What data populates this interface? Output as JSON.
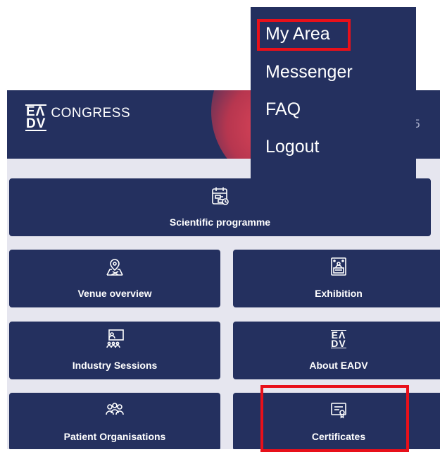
{
  "header": {
    "logo_top": "EΛ",
    "logo_bottom": "DV",
    "logo_text": "CONGRESS",
    "date_fragment": ")25"
  },
  "tiles": {
    "scientific_programme": "Scientific programme",
    "venue_overview": "Venue overview",
    "exhibition": "Exhibition",
    "industry_sessions": "Industry Sessions",
    "about_eadv": "About EADV",
    "patient_organisations": "Patient Organisations",
    "certificates": "Certificates"
  },
  "about_logo": {
    "top": "EΛ",
    "bottom": "DV"
  },
  "menu": {
    "items": [
      "My Area",
      "Messenger",
      "FAQ",
      "Logout"
    ]
  },
  "colors": {
    "navy": "#24305f",
    "background": "#e6e6ef",
    "highlight": "#e8101a",
    "accent_glow": "#e0475a"
  }
}
